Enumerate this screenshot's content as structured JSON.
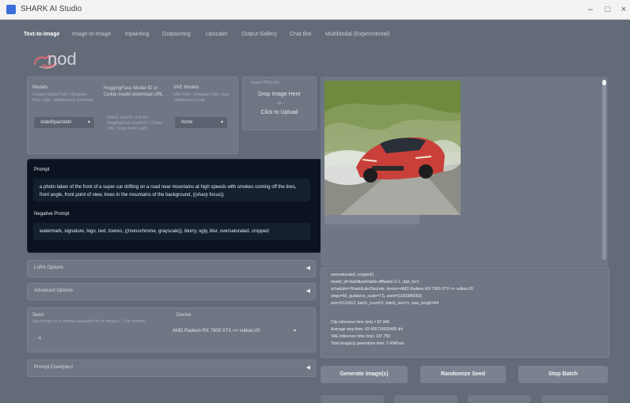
{
  "window": {
    "title": "SHARK AI Studio",
    "min": "–",
    "max": "□",
    "close": "×"
  },
  "tabs": [
    {
      "label": "Text-to-Image",
      "active": true
    },
    {
      "label": "Image-to-Image"
    },
    {
      "label": "Inpainting"
    },
    {
      "label": "Outpainting"
    },
    {
      "label": "Upscaler"
    },
    {
      "label": "Output Gallery"
    },
    {
      "label": "Chat Bot"
    },
    {
      "label": "MultiModal (Experimental)"
    }
  ],
  "brand": {
    "name": "nod"
  },
  "models": {
    "label": "Models",
    "help": "Custom Model Path / (Diagram Files .ckpt, .safetensors) download",
    "selected": "stabilityai/stabl"
  },
  "hf_model": {
    "label": "HuggingFace Model ID or Civitai model download URL",
    "help": "Select, Search, or Enter HuggingFace model ID / Civitai URL / local model path"
  },
  "vae": {
    "label": "VAE Models",
    "help": "VAE Path / (Diagram Files .ckpt, .safetensors) path",
    "selected": "None"
  },
  "png_import": {
    "label": "Import PNG info",
    "drop": "Drop Image Here",
    "or": "- or -",
    "click": "Click to Upload"
  },
  "prompt": {
    "label": "Prompt",
    "value": "a photo taken of the front of a super-car drifting on a road near mountains at high speeds with smokes coming off the tires, front angle, front point of view, trees in the mountains of the background, ((sharp focus))"
  },
  "negative_prompt": {
    "label": "Negative Prompt",
    "value": "watermark, signature, logo, text, lowres, ((monochrome, grayscale)), blurry, ugly, blur, oversaturated, cropped"
  },
  "accordions": {
    "lora": "LoRA Options",
    "advanced": "Advanced Options",
    "examples": "Prompt Examples!"
  },
  "seed": {
    "label": "Seed",
    "help": "Use integer or a comma-separated list of integers. -1 for random",
    "value": "-1"
  },
  "device": {
    "label": "Device",
    "selected": "AMD Radeon RX 7900 XTX => vulkan://0"
  },
  "info": {
    "lines": [
      "oversaturated, cropped']",
      "model_id=stabilityai/stable-diffusion-2-1, ckpt_loc=",
      "scheduler=SharkEulerDiscrete, device=AMD Radeon RX 7900 XTX => vulkan://0",
      "steps=50, guidance_scale=7.5, seed=[1183386053]",
      "size=512x512, batch_count=1, batch_size=1, max_length=64",
      "",
      "Clip Inference time (ms) = 87.346",
      "Average step time: 43.405716033405 it/s",
      "VAE Inference time (ms): 137.782",
      "Total image(s) generation time: 2.4345sec"
    ]
  },
  "buttons": {
    "generate": "Generate Image(s)",
    "randomize": "Randomize Seed",
    "stop": "Stop Batch"
  },
  "colors": {
    "accent_dark": "#0b1321",
    "panel": "#6f7684",
    "background": "#646b78"
  }
}
